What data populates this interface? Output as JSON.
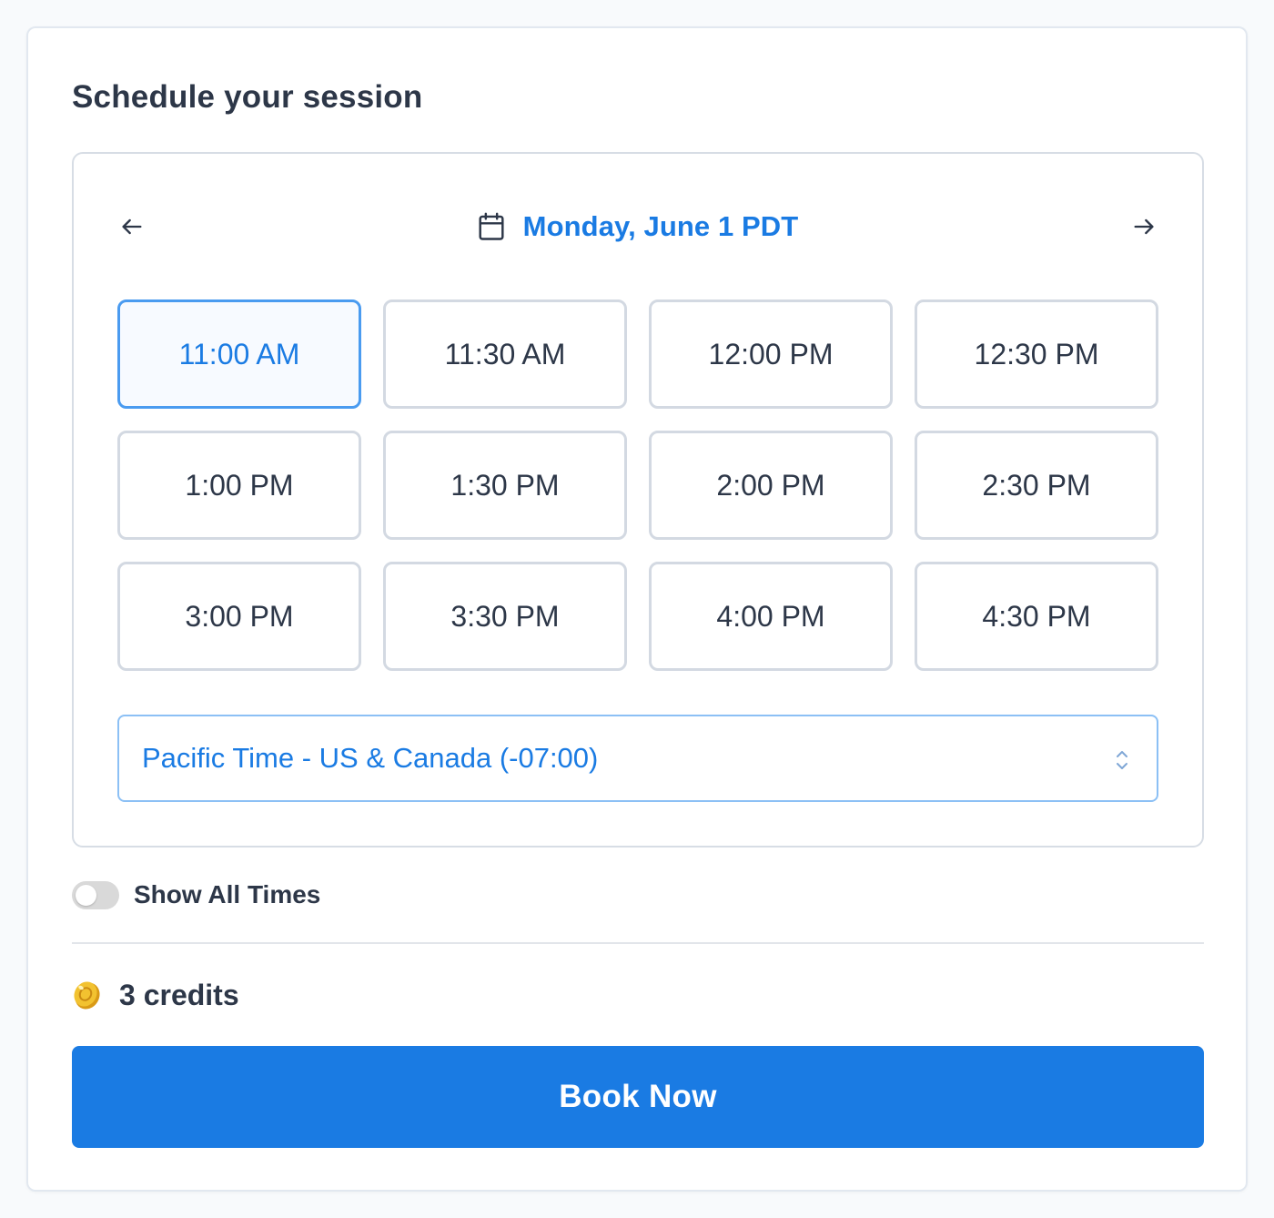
{
  "card": {
    "title": "Schedule your session"
  },
  "calendar": {
    "date_label": "Monday, June 1 PDT",
    "prev_icon": "arrow-left-icon",
    "next_icon": "arrow-right-icon",
    "calendar_icon": "calendar-icon"
  },
  "slots": [
    {
      "label": "11:00 AM",
      "selected": true
    },
    {
      "label": "11:30 AM",
      "selected": false
    },
    {
      "label": "12:00 PM",
      "selected": false
    },
    {
      "label": "12:30 PM",
      "selected": false
    },
    {
      "label": "1:00 PM",
      "selected": false
    },
    {
      "label": "1:30 PM",
      "selected": false
    },
    {
      "label": "2:00 PM",
      "selected": false
    },
    {
      "label": "2:30 PM",
      "selected": false
    },
    {
      "label": "3:00 PM",
      "selected": false
    },
    {
      "label": "3:30 PM",
      "selected": false
    },
    {
      "label": "4:00 PM",
      "selected": false
    },
    {
      "label": "4:30 PM",
      "selected": false
    }
  ],
  "timezone": {
    "selected": "Pacific Time - US & Canada (-07:00)",
    "icon": "chevron-up-down-icon"
  },
  "show_all_times": {
    "label": "Show All Times",
    "enabled": false
  },
  "credits": {
    "label": "3 credits",
    "icon": "coin-icon"
  },
  "book_button": {
    "label": "Book Now"
  },
  "colors": {
    "accent": "#1a7be3",
    "selected_border": "#4a9bf0",
    "text": "#2d3748",
    "slot_border": "#d3d9e2",
    "coin": "#f2c230"
  }
}
